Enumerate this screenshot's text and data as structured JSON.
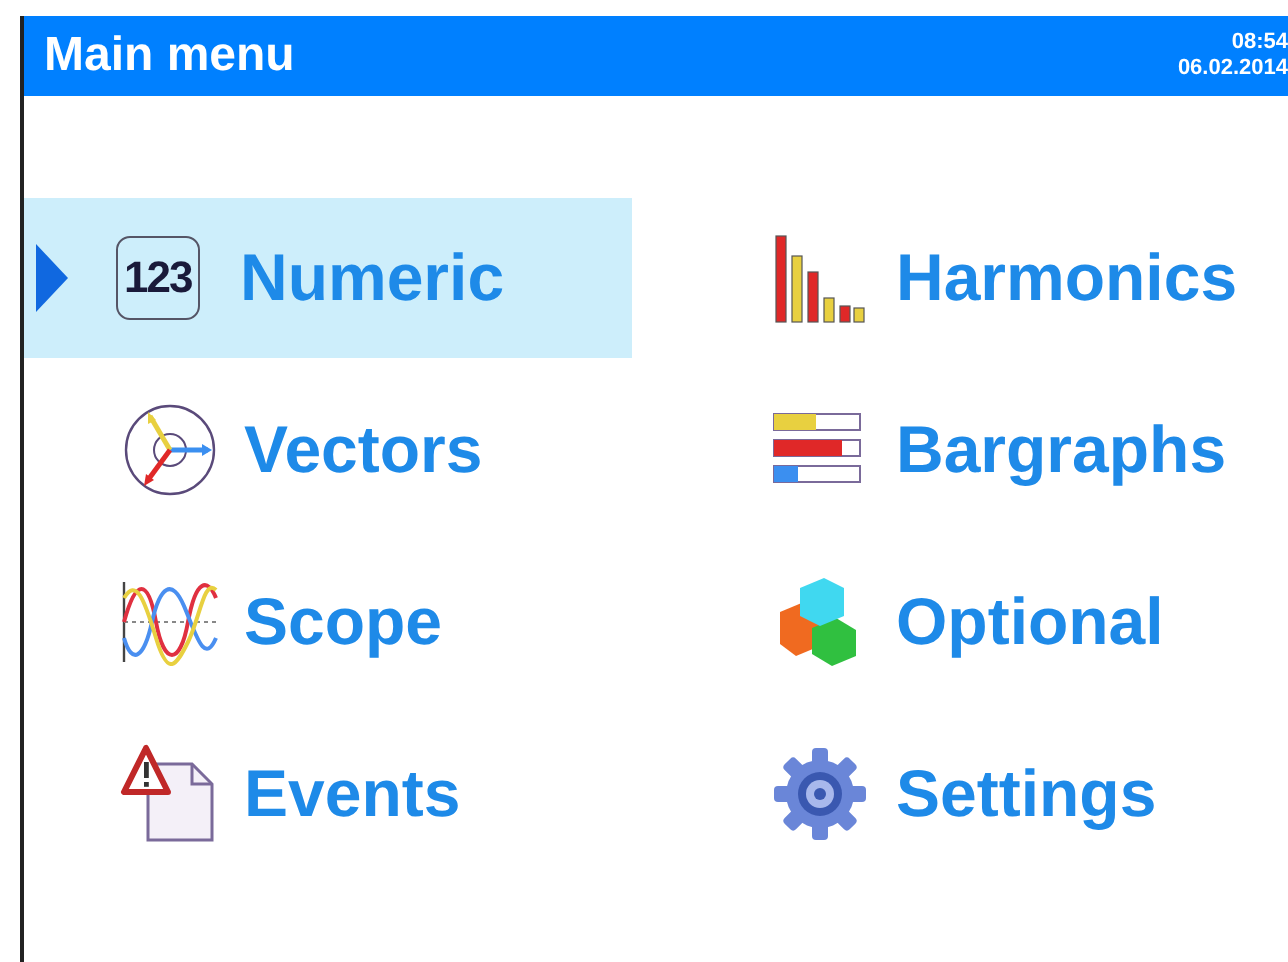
{
  "header": {
    "title": "Main menu",
    "time": "08:54",
    "date": "06.02.2014"
  },
  "columns": [
    {
      "items": [
        {
          "kind": "numeric",
          "label": "Numeric",
          "icon_text": "123",
          "selected": true
        },
        {
          "kind": "vectors",
          "label": "Vectors",
          "selected": false
        },
        {
          "kind": "scope",
          "label": "Scope",
          "selected": false
        },
        {
          "kind": "events",
          "label": "Events",
          "selected": false
        }
      ]
    },
    {
      "items": [
        {
          "kind": "harmonics",
          "label": "Harmonics",
          "selected": false
        },
        {
          "kind": "bargraphs",
          "label": "Bargraphs",
          "selected": false
        },
        {
          "kind": "optional",
          "label": "Optional",
          "selected": false
        },
        {
          "kind": "settings",
          "label": "Settings",
          "selected": false
        }
      ]
    }
  ]
}
